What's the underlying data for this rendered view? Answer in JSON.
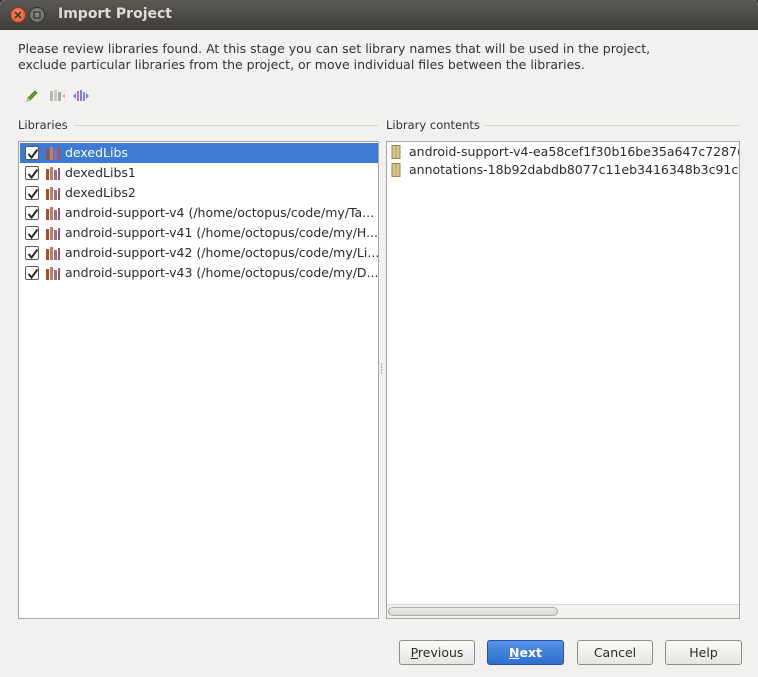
{
  "window": {
    "title": "Import Project"
  },
  "description": {
    "line1": "Please review libraries found. At this stage you can set library names that will be used in the project,",
    "line2": "exclude particular libraries from the project, or move individual files between the libraries."
  },
  "toolbar": {
    "icons": [
      "edit-pencil-icon",
      "merge-icon",
      "split-icon"
    ]
  },
  "libraries": {
    "label": "Libraries",
    "items": [
      {
        "name": "dexedLibs",
        "path": "",
        "checked": true,
        "selected": true
      },
      {
        "name": "dexedLibs1",
        "path": "",
        "checked": true,
        "selected": false
      },
      {
        "name": "dexedLibs2",
        "path": "",
        "checked": true,
        "selected": false
      },
      {
        "name": "android-support-v4",
        "path": "(/home/octopus/code/my/Ta...",
        "checked": true,
        "selected": false
      },
      {
        "name": "android-support-v41",
        "path": "(/home/octopus/code/my/H...",
        "checked": true,
        "selected": false
      },
      {
        "name": "android-support-v42",
        "path": "(/home/octopus/code/my/Li...",
        "checked": true,
        "selected": false
      },
      {
        "name": "android-support-v43",
        "path": "(/home/octopus/code/my/D...",
        "checked": true,
        "selected": false
      }
    ]
  },
  "library_contents": {
    "label": "Library contents",
    "items": [
      {
        "name": "android-support-v4-ea58cef1f30b16be35a647c7287("
      },
      {
        "name": "annotations-18b92dabdb8077c11eb3416348b3c91c"
      }
    ]
  },
  "buttons": {
    "previous": {
      "mnemonic": "P",
      "rest": "revious"
    },
    "next": {
      "mnemonic": "N",
      "rest": "ext"
    },
    "cancel": "Cancel",
    "help": "Help"
  },
  "colors": {
    "selection": "#3d7ad6",
    "default_button": "#2f6fcd",
    "titlebar": "#3d3c38",
    "close_button": "#e2532b"
  }
}
